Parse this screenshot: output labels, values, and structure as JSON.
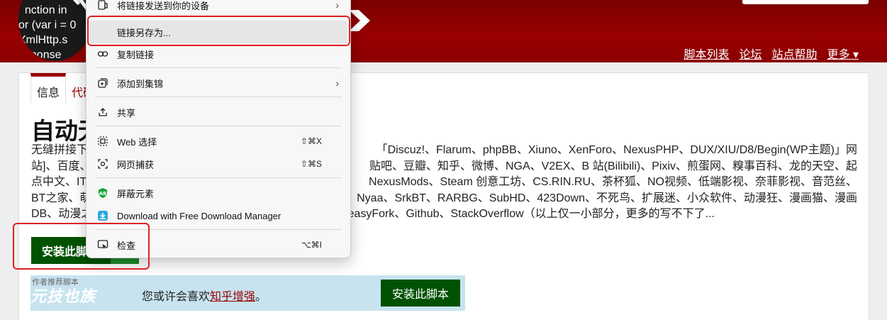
{
  "header": {
    "logo_code_lines": [
      "  nction in",
      "or (var i = 0",
      "XmlHttp.s",
      "esponse"
    ],
    "nav": [
      "脚本列表",
      "论坛",
      "站点帮助",
      "更多 ▾"
    ]
  },
  "tabs": [
    "信息",
    "代码"
  ],
  "script": {
    "title": "自动无",
    "desc_lines": [
      [
        "无缝拼接下",
        "「Discuz!、Flarum、phpBB、Xiuno、XenForo、NexusPHP、DUX/XIU/D8/Begin(WP主题)」网"
      ],
      [
        "站]、百度、",
        "贴吧、豆瓣、知乎、微博、NGA、V2EX、B 站(Bilibili)、Pixiv、煎蛋网、糗事百科、龙的天空、起"
      ],
      [
        "点中文、IT",
        "NexusMods、Steam 创意工坊、CS.RIN.RU、茶杯狐、NO视频、低端影视、奈菲影视、音范丝、"
      ],
      [
        "BT之家、萌",
        "Nyaa、SrkBT、RARBG、SubHD、423Down、不死鸟、扩展迷、小众软件、动漫狂、漫画猫、漫画"
      ],
      [
        "DB、动漫之",
        "reasyFork、Github、StackOverflow（以上仅一小部分，更多的写不下了..."
      ]
    ],
    "install_label": "安装此脚"
  },
  "recommend": {
    "label": "作者推荐脚本",
    "watermark": "元技也族",
    "text_prefix": "您或许会喜欢",
    "link": "知乎增强",
    "text_suffix": "。",
    "button": "安装此脚本"
  },
  "context_menu": {
    "items": [
      {
        "icon": "send-to-device-icon",
        "label": "将链接发送到你的设备",
        "shortcut": "",
        "submenu": true
      },
      {
        "icon": "",
        "label": "链接另存为...",
        "shortcut": "",
        "submenu": false
      },
      {
        "icon": "link-icon",
        "label": "复制链接",
        "shortcut": "",
        "submenu": false
      },
      {
        "icon": "collections-icon",
        "label": "添加到集锦",
        "shortcut": "",
        "submenu": true
      },
      {
        "icon": "share-icon",
        "label": "共享",
        "shortcut": "",
        "submenu": false
      },
      {
        "icon": "web-select-icon",
        "label": "Web 选择",
        "shortcut": "⇧⌘X",
        "submenu": false
      },
      {
        "icon": "web-capture-icon",
        "label": "网页捕获",
        "shortcut": "⇧⌘S",
        "submenu": false
      },
      {
        "icon": "block-element-icon",
        "label": "屏蔽元素",
        "shortcut": "",
        "submenu": false
      },
      {
        "icon": "download-manager-icon",
        "label": "Download with Free Download Manager",
        "shortcut": "",
        "submenu": false
      },
      {
        "icon": "inspect-icon",
        "label": "检查",
        "shortcut": "⌥⌘I",
        "submenu": false
      }
    ]
  },
  "colors": {
    "header": "#990000",
    "install": "#005200",
    "highlight": "#e02020"
  }
}
